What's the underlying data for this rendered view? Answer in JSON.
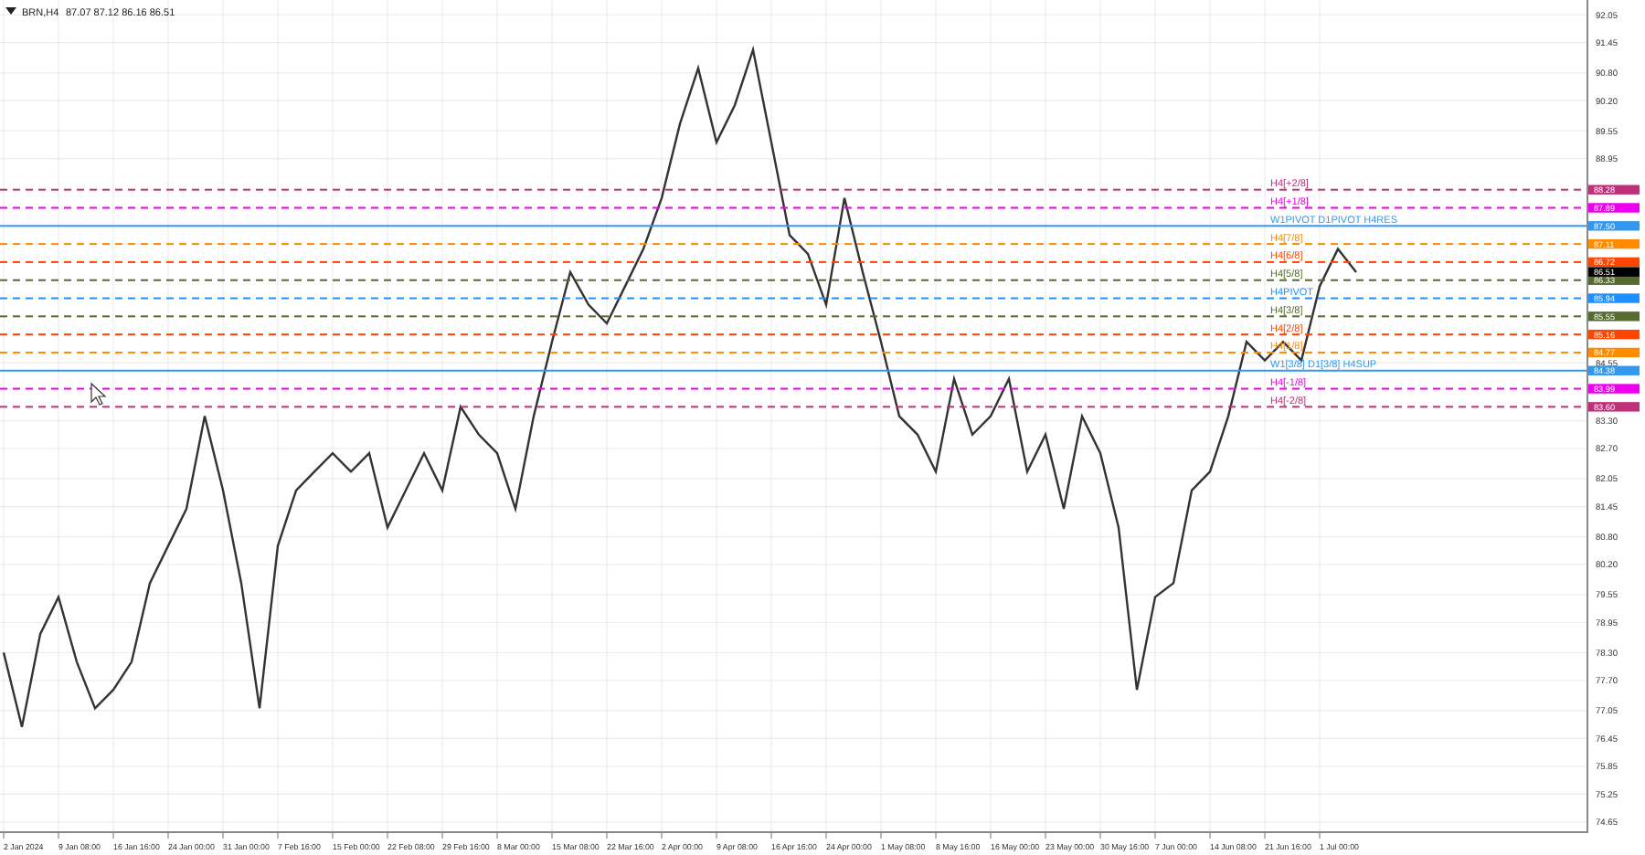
{
  "title": {
    "quote": "87.07 87.12 86.16 86.51"
  },
  "chart": {
    "time_labels": [
      "2 Jan 2024",
      "9 Jan 08:00",
      "16 Jan 16:00",
      "24 Jan 00:00",
      "31 Jan 00:00",
      "7 Feb 16:00",
      "15 Feb 00:00",
      "22 Feb 08:00",
      "29 Feb 16:00",
      "8 Mar 00:00",
      "15 Mar 08:00",
      "22 Mar 16:00",
      "2 Apr 00:00",
      "9 Apr 08:00",
      "16 Apr 16:00",
      "24 Apr 00:00",
      "1 May 08:00",
      "8 May 16:00",
      "16 May 00:00",
      "23 May 00:00",
      "30 May 16:00",
      "7 Jun 00:00",
      "14 Jun 08:00",
      "21 Jun 16:00",
      "1 Jul 00:00"
    ],
    "chart_data": {
      "type": "line",
      "grid": true,
      "ylim": [
        74.45,
        92.37
      ],
      "yticks": [
        {
          "value": 92.05,
          "label": "92.05"
        },
        {
          "value": 91.45,
          "label": "91.45"
        },
        {
          "value": 90.8,
          "label": "90.80"
        },
        {
          "value": 90.2,
          "label": "90.20"
        },
        {
          "value": 89.55,
          "label": "89.55"
        },
        {
          "value": 88.95,
          "label": "88.95"
        },
        {
          "value": 84.55,
          "label": "84.55"
        },
        {
          "value": 83.3,
          "label": "83.30"
        },
        {
          "value": 82.7,
          "label": "82.70"
        },
        {
          "value": 82.05,
          "label": "82.05"
        },
        {
          "value": 81.45,
          "label": "81.45"
        },
        {
          "value": 80.8,
          "label": "80.80"
        },
        {
          "value": 80.2,
          "label": "80.20"
        },
        {
          "value": 79.55,
          "label": "79.55"
        },
        {
          "value": 78.95,
          "label": "78.95"
        },
        {
          "value": 78.3,
          "label": "78.30"
        },
        {
          "value": 77.7,
          "label": "77.70"
        },
        {
          "value": 77.05,
          "label": "77.05"
        },
        {
          "value": 76.45,
          "label": "76.45"
        },
        {
          "value": 75.85,
          "label": "75.85"
        },
        {
          "value": 75.25,
          "label": "75.25"
        },
        {
          "value": 74.65,
          "label": "74.65"
        }
      ],
      "series": [
        {
          "name": "BRN,H4",
          "color": "#333333",
          "values": [
            78.3,
            76.7,
            78.7,
            79.5,
            78.1,
            77.1,
            77.5,
            78.1,
            79.8,
            80.6,
            81.4,
            83.4,
            81.8,
            79.8,
            77.1,
            80.6,
            81.8,
            82.2,
            82.6,
            82.2,
            82.6,
            81.0,
            81.8,
            82.6,
            81.8,
            83.6,
            83.0,
            82.6,
            81.4,
            83.4,
            85.0,
            86.5,
            85.8,
            85.4,
            86.2,
            87.0,
            88.1,
            89.7,
            90.9,
            89.3,
            90.1,
            91.3,
            89.3,
            87.3,
            86.9,
            85.8,
            88.1,
            86.5,
            85.0,
            83.4,
            83.0,
            82.2,
            84.2,
            83.0,
            83.4,
            84.2,
            82.2,
            83.0,
            81.4,
            83.4,
            82.6,
            81.0,
            77.5,
            79.5,
            79.8,
            81.8,
            82.2,
            83.4,
            85.0,
            84.6,
            85.0,
            84.6,
            86.2,
            87.0,
            86.5
          ]
        }
      ]
    }
  },
  "levels": [
    {
      "label": "H4[+2/8]",
      "price": "88.28",
      "color": "#c0307a",
      "dashed": true
    },
    {
      "label": "H4[+1/8]",
      "price": "87.89",
      "color": "#ee00ee",
      "dashed": true
    },
    {
      "label": "W1PIVOT D1PIVOT H4RES",
      "price": "87.50",
      "color": "#3399ee",
      "dashed": false
    },
    {
      "label": "H4[7/8]",
      "price": "87.11",
      "color": "#ff8c00",
      "dashed": true
    },
    {
      "label": "H4[6/8]",
      "price": "86.72",
      "color": "#ff4500",
      "dashed": true
    },
    {
      "label": "H4[5/8]",
      "price": "86.33",
      "color": "#556b2f",
      "dashed": true
    },
    {
      "label": "H4PIVOT",
      "price": "85.94",
      "color": "#1e90ff",
      "dashed": true
    },
    {
      "label": "H4[3/8]",
      "price": "85.55",
      "color": "#556b2f",
      "dashed": true
    },
    {
      "label": "H4[2/8]",
      "price": "85.16",
      "color": "#ff4500",
      "dashed": true
    },
    {
      "label": "H4[1/8]",
      "price": "84.77",
      "color": "#ff8c00",
      "dashed": true
    },
    {
      "label": "W1[3/8] D1[3/8] H4SUP",
      "price": "84.38",
      "color": "#3399ee",
      "dashed": false
    },
    {
      "label": "H4[-1/8]",
      "price": "83.99",
      "color": "#ee00ee",
      "dashed": true
    },
    {
      "label": "H4[-2/8]",
      "price": "83.60",
      "color": "#c0307a",
      "dashed": true
    }
  ],
  "current_price": "86.51"
}
